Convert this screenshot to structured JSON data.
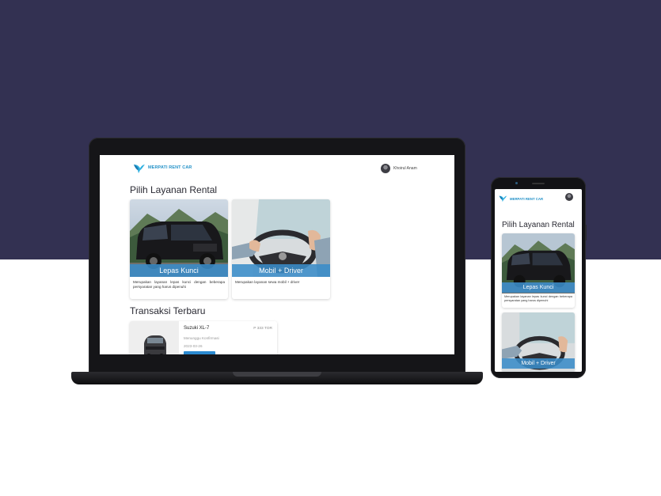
{
  "brand": {
    "name": "MERPATI RENT CAR",
    "color": "#2592c8"
  },
  "user": {
    "name": "Khoirul Anam"
  },
  "sections": {
    "services_title": "Pilih Layanan Rental",
    "transactions_title": "Transaksi Terbaru"
  },
  "services": [
    {
      "label": "Lepas Kunci",
      "desc": "Merupakan layanan lepas kunci dengan beberapa persyaratan yang harus dipenuhi"
    },
    {
      "label": "Mobil + Driver",
      "desc": "Merupakan layanan sewa mobil + driver"
    }
  ],
  "transaction": {
    "car": "Suzuki XL-7",
    "price": "P 333 TOR",
    "status": "Menunggu Konfirmasi",
    "date": "2023-03-26"
  },
  "colors": {
    "background_top": "#333152",
    "accent": "#2b8ad0",
    "band": "#3a8cc8"
  },
  "icons": {
    "logo": "bird-logo-icon",
    "avatar": "user-avatar"
  }
}
